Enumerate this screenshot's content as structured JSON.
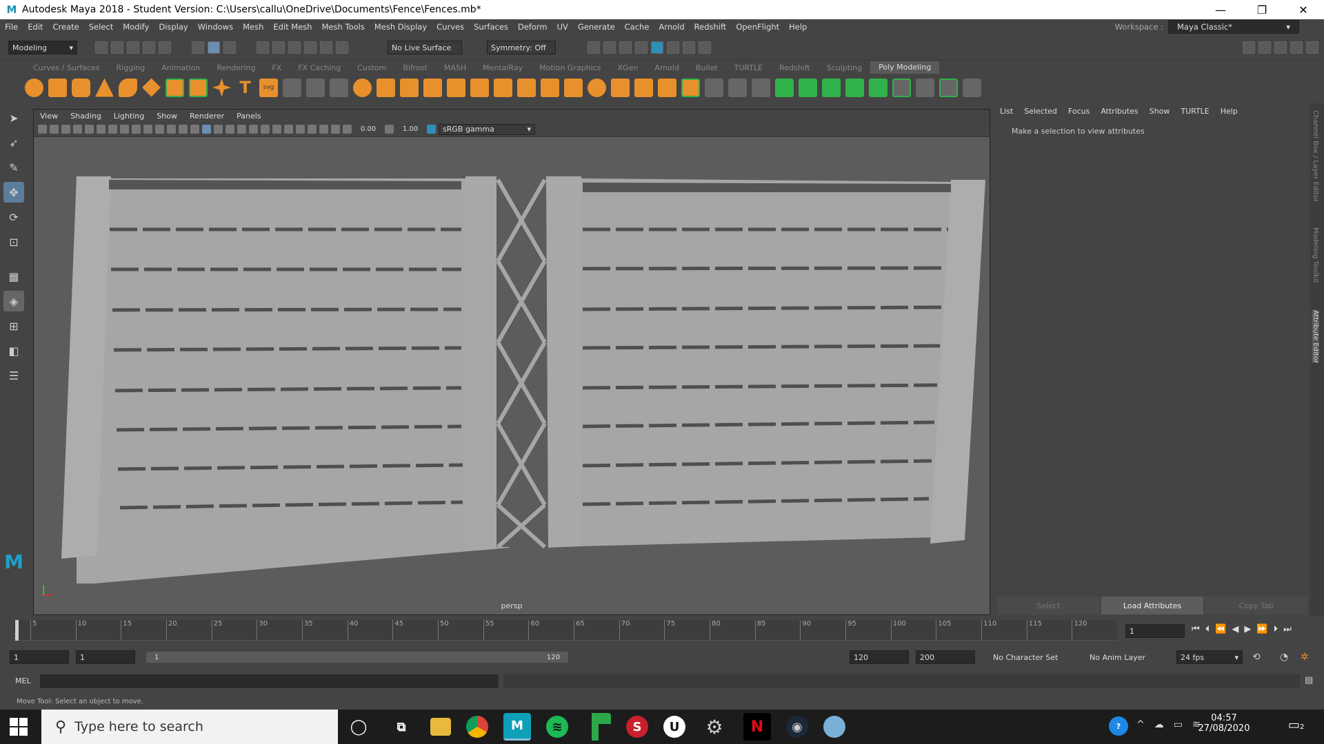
{
  "window": {
    "title": "Autodesk Maya 2018 - Student Version: C:\\Users\\callu\\OneDrive\\Documents\\Fence\\Fences.mb*"
  },
  "menu": [
    "File",
    "Edit",
    "Create",
    "Select",
    "Modify",
    "Display",
    "Windows",
    "Mesh",
    "Edit Mesh",
    "Mesh Tools",
    "Mesh Display",
    "Curves",
    "Surfaces",
    "Deform",
    "UV",
    "Generate",
    "Cache",
    "Arnold",
    "Redshift",
    "OpenFlight",
    "Help"
  ],
  "workspace": {
    "label": "Workspace :",
    "value": "Maya Classic*"
  },
  "status": {
    "mode": "Modeling",
    "live_surface": "No Live Surface",
    "symmetry": "Symmetry: Off"
  },
  "shelf_tabs": [
    "Curves / Surfaces",
    "Rigging",
    "Animation",
    "Rendering",
    "FX",
    "FX Caching",
    "Custom",
    "Bifrost",
    "MASH",
    "MentalRay",
    "Motion Graphics",
    "XGen",
    "Arnold",
    "Bullet",
    "TURTLE",
    "Redshift",
    "Sculpting",
    "Poly Modeling"
  ],
  "viewport": {
    "menu": [
      "View",
      "Shading",
      "Lighting",
      "Show",
      "Renderer",
      "Panels"
    ],
    "exposure": "0.00",
    "gamma": "1.00",
    "colorspace": "sRGB gamma",
    "camera": "persp"
  },
  "attr_editor": {
    "menu": [
      "List",
      "Selected",
      "Focus",
      "Attributes",
      "Show",
      "TURTLE",
      "Help"
    ],
    "message": "Make a selection to view attributes",
    "buttons": {
      "select": "Select",
      "load": "Load Attributes",
      "copy": "Copy Tab"
    },
    "side_tabs": [
      "Channel Box / Layer Editor",
      "Modeling Toolkit",
      "Attribute Editor"
    ]
  },
  "timeline": {
    "ticks": [
      "1",
      "5",
      "10",
      "15",
      "20",
      "25",
      "30",
      "35",
      "40",
      "45",
      "50",
      "55",
      "60",
      "65",
      "70",
      "75",
      "80",
      "85",
      "90",
      "95",
      "100",
      "105",
      "110",
      "115",
      "120"
    ],
    "current_frame": "1"
  },
  "range": {
    "start": "1",
    "playback_start": "1",
    "slider_start": "1",
    "slider_end": "120",
    "playback_end": "120",
    "end": "200",
    "char_set": "No Character Set",
    "anim_layer": "No Anim Layer",
    "fps": "24 fps"
  },
  "mel": {
    "label": "MEL"
  },
  "help_line": "Move Tool: Select an object to move.",
  "taskbar": {
    "search_placeholder": "Type here to search",
    "time": "04:57",
    "date": "27/08/2020",
    "notifications": "2"
  }
}
